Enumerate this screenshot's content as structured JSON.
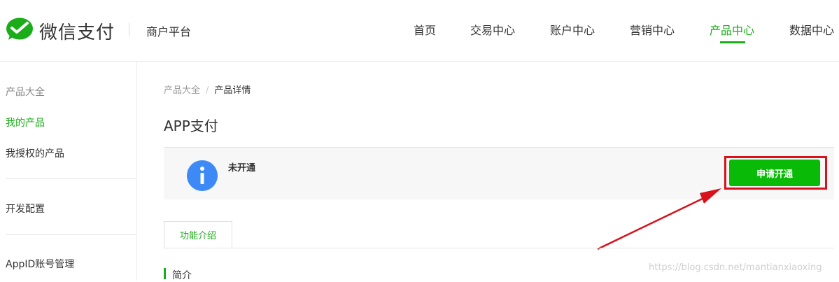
{
  "header": {
    "brand": "微信支付",
    "platform": "商户平台",
    "nav": [
      {
        "label": "首页",
        "active": false
      },
      {
        "label": "交易中心",
        "active": false
      },
      {
        "label": "账户中心",
        "active": false
      },
      {
        "label": "营销中心",
        "active": false
      },
      {
        "label": "产品中心",
        "active": true
      },
      {
        "label": "数据中心",
        "active": false
      }
    ]
  },
  "sidebar": {
    "items": [
      {
        "label": "产品大全"
      },
      {
        "label": "我的产品"
      },
      {
        "label": "我授权的产品"
      },
      {
        "label": "开发配置"
      },
      {
        "label": "AppID账号管理"
      }
    ]
  },
  "main": {
    "breadcrumb": {
      "root": "产品大全",
      "separator": "/",
      "current": "产品详情"
    },
    "title": "APP支付",
    "status": {
      "text": "未开通",
      "button_label": "申请开通"
    },
    "tab": "功能介绍",
    "section_title": "简介"
  },
  "watermark": "https://blog.csdn.net/mantianxiaoxing",
  "colors": {
    "accent": "#1aad19",
    "button": "#09bb07",
    "info": "#3d8af7",
    "annotation": "#d8111b"
  },
  "icons": {
    "logo": "wechat-pay-logo-icon",
    "info": "info-icon",
    "arrow": "annotation-arrow"
  }
}
